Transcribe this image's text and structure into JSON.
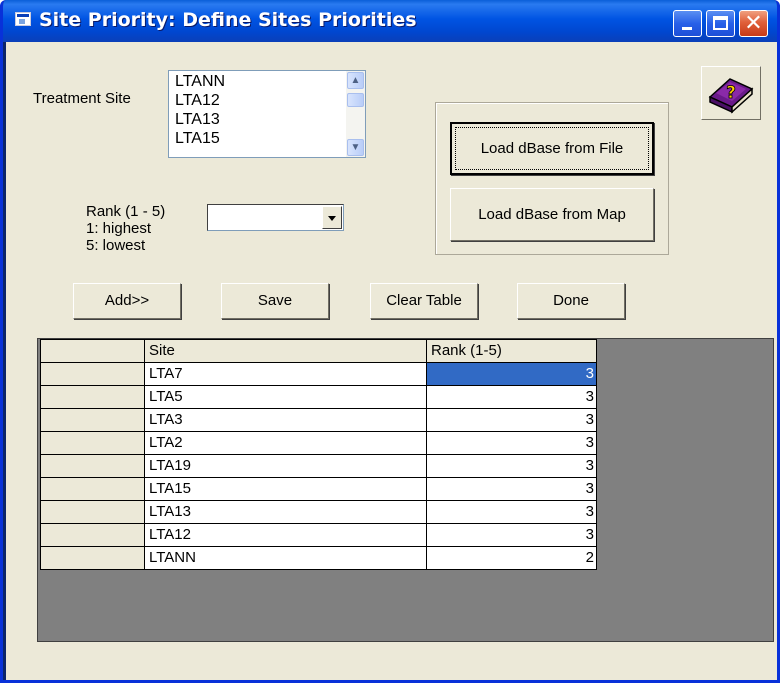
{
  "window": {
    "title": "Site Priority: Define Sites Priorities"
  },
  "treatment_site": {
    "label": "Treatment Site",
    "items": [
      "LTANN",
      "LTA12",
      "LTA13",
      "LTA15"
    ]
  },
  "rank": {
    "label_line1": "Rank (1 - 5)",
    "label_line2": "1: highest",
    "label_line3": "5: lowest",
    "selected_value": ""
  },
  "buttons": {
    "load_file": "Load dBase from File",
    "load_map": "Load dBase from Map",
    "add": "Add>>",
    "save": "Save",
    "clear_table": "Clear Table",
    "done": "Done"
  },
  "table": {
    "headers": [
      "",
      "Site",
      "Rank (1-5)"
    ],
    "rows": [
      {
        "site": "LTA7",
        "rank": "3"
      },
      {
        "site": "LTA5",
        "rank": "3"
      },
      {
        "site": "LTA3",
        "rank": "3"
      },
      {
        "site": "LTA2",
        "rank": "3"
      },
      {
        "site": "LTA19",
        "rank": "3"
      },
      {
        "site": "LTA15",
        "rank": "3"
      },
      {
        "site": "LTA13",
        "rank": "3"
      },
      {
        "site": "LTA12",
        "rank": "3"
      },
      {
        "site": "LTANN",
        "rank": "2"
      }
    ]
  },
  "icons": [
    "app-icon",
    "minimize-icon",
    "maximize-icon",
    "close-icon",
    "help-book-icon",
    "scroll-up-icon",
    "scroll-down-icon",
    "dropdown-arrow-icon"
  ],
  "colors": {
    "titlebar": "#0054e3",
    "face": "#ece9d8",
    "selection": "#316ac5",
    "grid_background": "#808080"
  }
}
